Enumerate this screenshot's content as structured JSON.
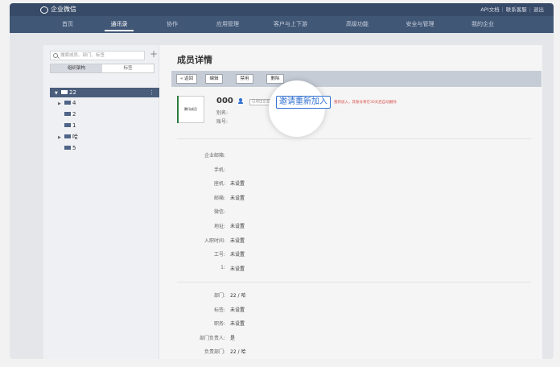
{
  "topbar": {
    "logo_text": "企业微信",
    "links": [
      "API文档",
      "联系客服",
      "退出"
    ]
  },
  "nav": {
    "items": [
      "首页",
      "通讯录",
      "协作",
      "应用管理",
      "客户与上下游",
      "高级功能",
      "安全与管理",
      "我的企业"
    ],
    "active_index": 1
  },
  "left": {
    "search_placeholder": "搜索成员、部门、标签",
    "tabs": [
      "组织架构",
      "标签"
    ],
    "tree_root": "22",
    "tree_items": [
      "4",
      "2",
      "1",
      "哈",
      "5"
    ]
  },
  "right": {
    "title": "成员详情",
    "buttons": [
      "« 返回",
      "编辑",
      "禁用",
      "删除"
    ],
    "member": {
      "avatar_text": "腾讯成员",
      "name": "000",
      "badge": "已退出企业",
      "invite_label": "邀请重新加入",
      "warning": "重新加入，其账号将在30天后自动删除",
      "alias_label": "别名:",
      "account_label": "账号:"
    },
    "fields1": [
      {
        "label": "企业邮箱:",
        "value": ""
      },
      {
        "label": "手机:",
        "value": ""
      },
      {
        "label": "座机:",
        "value": "未设置"
      },
      {
        "label": "邮箱:",
        "value": "未设置"
      },
      {
        "label": "微信:",
        "value": ""
      },
      {
        "label": "地址:",
        "value": "未设置"
      },
      {
        "label": "入职时间:",
        "value": "未设置"
      },
      {
        "label": "工号:",
        "value": "未设置"
      },
      {
        "label": "1:",
        "value": "未设置"
      }
    ],
    "fields2": [
      {
        "label": "部门:",
        "value": "22 / 哈"
      },
      {
        "label": "标签:",
        "value": "未设置"
      },
      {
        "label": "职务:",
        "value": "未设置"
      },
      {
        "label": "部门负责人:",
        "value": "是"
      },
      {
        "label": "负责部门:",
        "value": "22 / 哈"
      }
    ]
  }
}
